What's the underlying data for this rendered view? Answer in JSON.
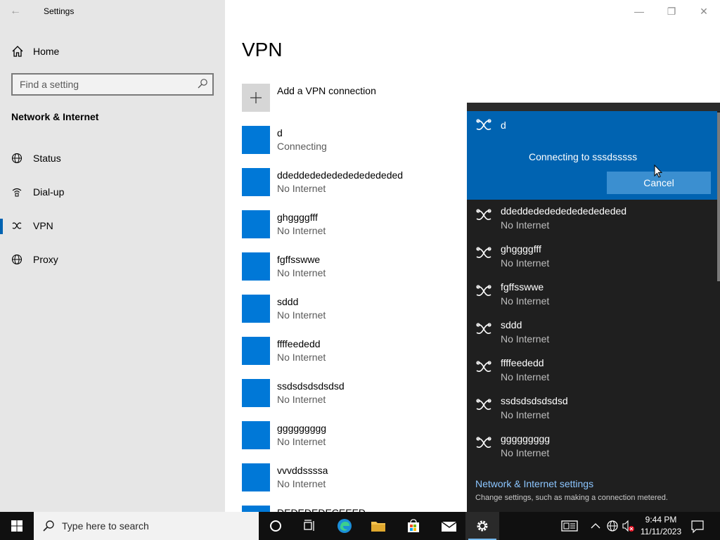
{
  "window": {
    "title": "Settings",
    "back_glyph": "←",
    "min_glyph": "—",
    "max_glyph": "❐",
    "close_glyph": "✕"
  },
  "sidebar": {
    "home_label": "Home",
    "search_placeholder": "Find a setting",
    "section_title": "Network & Internet",
    "items": [
      {
        "label": "Status",
        "icon": "globe-icon"
      },
      {
        "label": "Dial-up",
        "icon": "dialup-icon"
      },
      {
        "label": "VPN",
        "icon": "vpn-icon",
        "selected": true
      },
      {
        "label": "Proxy",
        "icon": "globe-icon"
      }
    ]
  },
  "main": {
    "title": "VPN",
    "add_label": "Add a VPN connection",
    "connections": [
      {
        "name": "d",
        "status": "Connecting"
      },
      {
        "name": "ddeddededededededededed",
        "status": "No Internet"
      },
      {
        "name": "ghggggfff",
        "status": "No Internet"
      },
      {
        "name": "fgffsswwe",
        "status": "No Internet"
      },
      {
        "name": "sddd",
        "status": "No Internet"
      },
      {
        "name": "ffffeededd",
        "status": "No Internet"
      },
      {
        "name": "ssdsdsdsdsdsd",
        "status": "No Internet"
      },
      {
        "name": "ggggggggg",
        "status": "No Internet"
      },
      {
        "name": "vvvddssssa",
        "status": "No Internet"
      },
      {
        "name": "DEDEDEDECEEED",
        "status": ""
      }
    ]
  },
  "flyout": {
    "active": {
      "name": "d",
      "message": "Connecting to sssdsssss",
      "cancel_label": "Cancel"
    },
    "items": [
      {
        "name": "ddeddededededededededed",
        "status": "No Internet"
      },
      {
        "name": "ghggggfff",
        "status": "No Internet"
      },
      {
        "name": "fgffsswwe",
        "status": "No Internet"
      },
      {
        "name": "sddd",
        "status": "No Internet"
      },
      {
        "name": "ffffeededd",
        "status": "No Internet"
      },
      {
        "name": "ssdsdsdsdsdsd",
        "status": "No Internet"
      },
      {
        "name": "ggggggggg",
        "status": "No Internet"
      }
    ],
    "settings_link": "Network & Internet settings",
    "settings_desc": "Change settings, such as making a connection metered."
  },
  "taskbar": {
    "search_placeholder": "Type here to search",
    "time": "9:44 PM",
    "date": "11/11/2023",
    "accent": "#76b9ed"
  },
  "colors": {
    "tile_blue": "#0078d7",
    "flyout_active": "#0063b1",
    "flyout_bg": "#1f1f1f"
  }
}
